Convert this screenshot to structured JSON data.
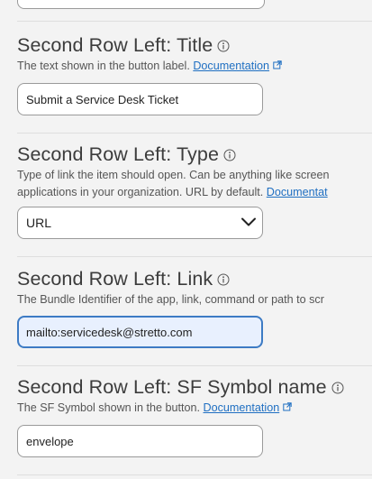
{
  "sections": [
    {
      "title": "Second Row Left: Title",
      "description": "The text shown in the button label.",
      "doc_link": "Documentation",
      "value": "Submit a Service Desk Ticket"
    },
    {
      "title": "Second Row Left: Type",
      "description_line1": "Type of link the item should open. Can be anything like screen",
      "description_line2": "applications in your organization. URL by default.",
      "doc_link": "Documentat",
      "selected": "URL"
    },
    {
      "title": "Second Row Left: Link",
      "description": "The Bundle Identifier of the app, link, command or path to scr",
      "value": "mailto:servicedesk@stretto.com"
    },
    {
      "title": "Second Row Left: SF Symbol name",
      "description": "The SF Symbol shown in the button.",
      "doc_link": "Documentation",
      "value": "envelope"
    }
  ],
  "colors": {
    "link": "#1f6fc2",
    "focus_border": "#3d7bc4",
    "focus_bg": "#e8f0fe"
  }
}
